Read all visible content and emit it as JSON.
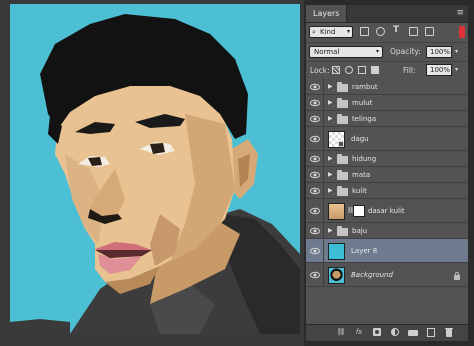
{
  "panel": {
    "tab_label": "Layers",
    "menu_glyph": "≡",
    "filter": {
      "kind_label": "Kind",
      "icons": [
        "pixel-filter-icon",
        "adjustment-filter-icon",
        "type-filter-icon",
        "shape-filter-icon",
        "smart-object-filter-icon"
      ],
      "type_glyph": "T"
    },
    "blend_mode": "Normal",
    "opacity_label": "Opacity:",
    "opacity_value": "100%",
    "lock_label": "Lock:",
    "fill_label": "Fill:",
    "fill_value": "100%"
  },
  "layers": [
    {
      "name": "rambut",
      "kind": "group"
    },
    {
      "name": "mulut",
      "kind": "group"
    },
    {
      "name": "telinga",
      "kind": "group"
    },
    {
      "name": "dagu",
      "kind": "smart"
    },
    {
      "name": "hidung",
      "kind": "group"
    },
    {
      "name": "mata",
      "kind": "group"
    },
    {
      "name": "kulit",
      "kind": "group"
    },
    {
      "name": "dasar kulit",
      "kind": "masked"
    },
    {
      "name": "baju",
      "kind": "group"
    },
    {
      "name": "Layer 8",
      "kind": "fill",
      "selected": true
    },
    {
      "name": "Background",
      "kind": "background",
      "locked": true
    }
  ],
  "colors": {
    "canvas_background": "#4dbfd4",
    "selected_layer": "#6e7b8f",
    "layer8_fill": "#3cbfd4"
  },
  "footer_icons": [
    "link-layers-icon",
    "fx-icon",
    "add-mask-icon",
    "adjustment-layer-icon",
    "new-group-icon",
    "new-layer-icon",
    "delete-layer-icon"
  ],
  "footer_glyphs": {
    "link": "⛓",
    "fx": "fx"
  }
}
